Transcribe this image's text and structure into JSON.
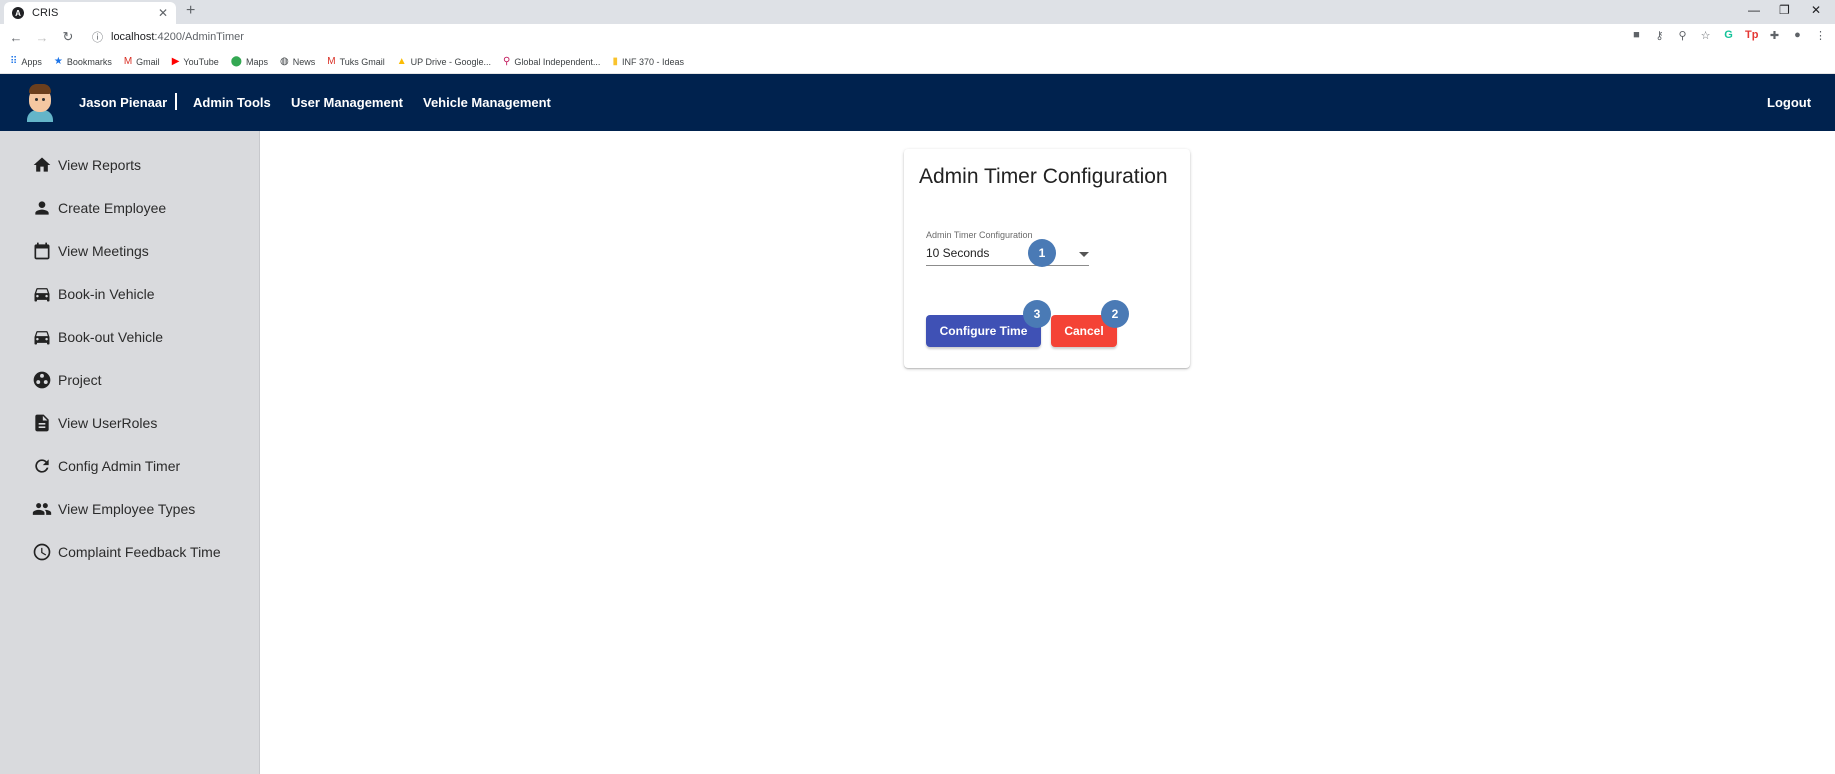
{
  "browser": {
    "tab_title": "CRIS",
    "tab_favicon": "A",
    "url_host": "localhost",
    "url_path": ":4200/AdminTimer",
    "bookmarks": [
      {
        "icon": "apps-grid-icon",
        "glyph": "⠿",
        "label": "Apps",
        "color": "#1a73e8"
      },
      {
        "icon": "star-icon",
        "glyph": "★",
        "label": "Bookmarks",
        "color": "#1a73e8"
      },
      {
        "icon": "gmail-icon",
        "glyph": "M",
        "label": "Gmail",
        "color": "#d93025"
      },
      {
        "icon": "youtube-icon",
        "glyph": "▶",
        "label": "YouTube",
        "color": "#ff0000"
      },
      {
        "icon": "maps-pin-icon",
        "glyph": "⬤",
        "label": "Maps",
        "color": "#34a853"
      },
      {
        "icon": "globe-icon",
        "glyph": "◍",
        "label": "News",
        "color": "#3c4043"
      },
      {
        "icon": "gmail-icon",
        "glyph": "M",
        "label": "Tuks Gmail",
        "color": "#d93025"
      },
      {
        "icon": "drive-icon",
        "glyph": "▲",
        "label": "UP Drive - Google...",
        "color": "#fbbc04"
      },
      {
        "icon": "link-icon",
        "glyph": "⚲",
        "label": "Global Independent...",
        "color": "#c2185b"
      },
      {
        "icon": "note-icon",
        "glyph": "▮",
        "label": "INF 370 - Ideas",
        "color": "#f9c32c"
      }
    ]
  },
  "header": {
    "user_name": "Jason Pienaar",
    "links": [
      "Admin Tools",
      "User Management",
      "Vehicle Management"
    ],
    "logout": "Logout"
  },
  "sidebar": {
    "items": [
      {
        "label": "View Reports",
        "icon": "home-icon"
      },
      {
        "label": "Create Employee",
        "icon": "person-icon"
      },
      {
        "label": "View Meetings",
        "icon": "calendar-icon"
      },
      {
        "label": "Book-in Vehicle",
        "icon": "car-icon"
      },
      {
        "label": "Book-out Vehicle",
        "icon": "car-icon"
      },
      {
        "label": "Project",
        "icon": "project-icon"
      },
      {
        "label": "View UserRoles",
        "icon": "document-icon"
      },
      {
        "label": "Config Admin Timer",
        "icon": "refresh-icon"
      },
      {
        "label": "View Employee Types",
        "icon": "people-icon"
      },
      {
        "label": "Complaint Feedback Time",
        "icon": "clock-icon"
      }
    ]
  },
  "card": {
    "title": "Admin Timer Configuration",
    "field_label": "Admin Timer Configuration",
    "field_value": "10 Seconds",
    "configure_button": "Configure Time",
    "cancel_button": "Cancel"
  },
  "markers": [
    "1",
    "2",
    "3"
  ],
  "colors": {
    "appbar": "#00224e",
    "sidebar": "#d9dadd",
    "primary": "#3f51b5",
    "warn": "#f44336",
    "marker": "#4a7ab5"
  }
}
